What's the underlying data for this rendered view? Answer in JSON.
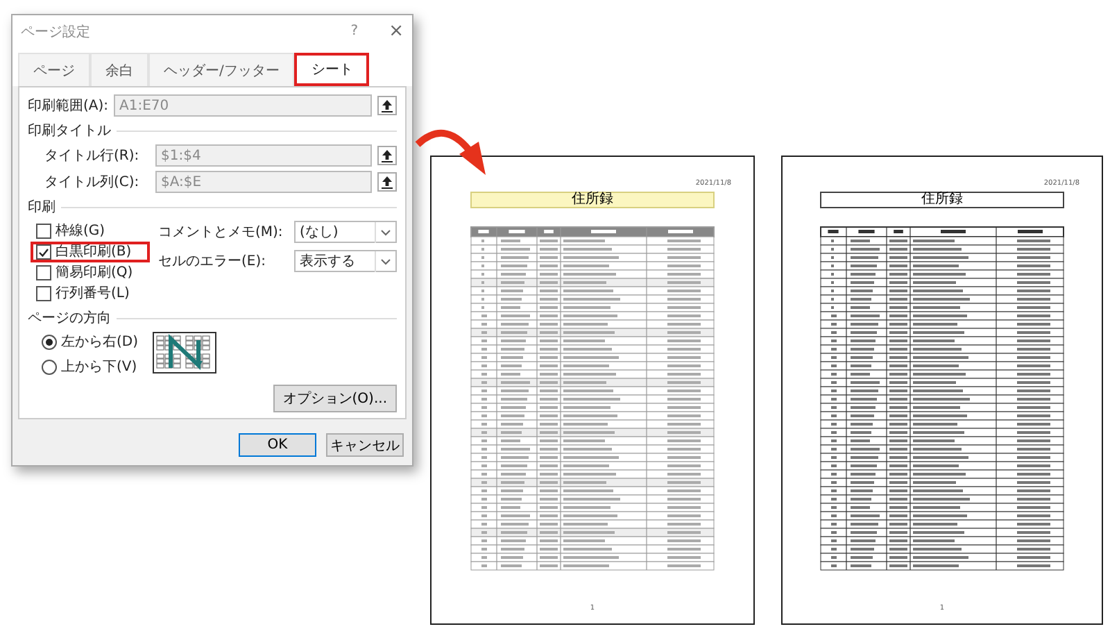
{
  "dialog": {
    "title": "ページ設定",
    "help": "?",
    "close": "×",
    "tabs": [
      {
        "label": "ページ",
        "selected": false,
        "highlighted": false
      },
      {
        "label": "余白",
        "selected": false,
        "highlighted": false
      },
      {
        "label": "ヘッダー/フッター",
        "selected": false,
        "highlighted": false
      },
      {
        "label": "シート",
        "selected": true,
        "highlighted": true
      }
    ],
    "print_area": {
      "label": "印刷範囲(A):",
      "value": "A1:E70"
    },
    "print_titles": {
      "heading": "印刷タイトル",
      "fields": [
        {
          "label": "タイトル行(R):",
          "value": "$1:$4"
        },
        {
          "label": "タイトル列(C):",
          "value": "$A:$E"
        }
      ]
    },
    "print": {
      "heading": "印刷",
      "checkboxes": [
        {
          "label": "枠線(G)",
          "checked": false,
          "highlighted": false
        },
        {
          "label": "白黒印刷(B)",
          "checked": true,
          "highlighted": true
        },
        {
          "label": "簡易印刷(Q)",
          "checked": false,
          "highlighted": false
        },
        {
          "label": "行列番号(L)",
          "checked": false,
          "highlighted": false
        }
      ],
      "dropdowns": [
        {
          "label": "コメントとメモ(M):",
          "value": "(なし)"
        },
        {
          "label": "セルのエラー(E):",
          "value": "表示する"
        }
      ]
    },
    "page_order": {
      "heading": "ページの方向",
      "options": [
        {
          "label": "左から右(D)",
          "selected": true
        },
        {
          "label": "上から下(V)",
          "selected": false
        }
      ]
    },
    "options_button": "オプション(O)...",
    "buttons": [
      "OK",
      "キャンセル"
    ]
  },
  "pages": [
    {
      "date": "2021/11/8",
      "title": "住所録",
      "monochrome": false,
      "page_number": "1"
    },
    {
      "date": "2021/11/8",
      "title": "住所録",
      "monochrome": true,
      "page_number": "1"
    }
  ]
}
